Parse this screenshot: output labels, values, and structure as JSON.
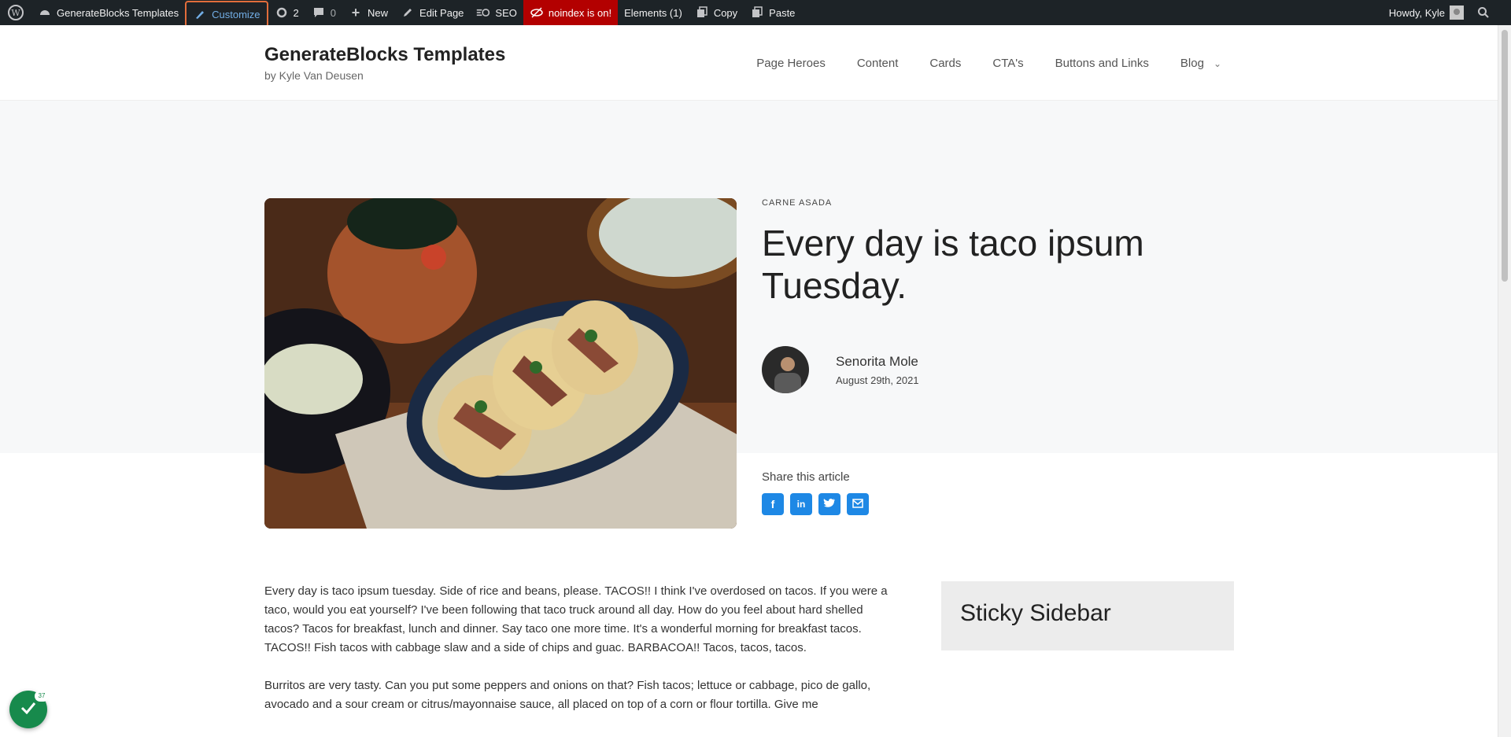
{
  "admin_bar": {
    "site_name": "GenerateBlocks Templates",
    "customize": "Customize",
    "updates_count": "2",
    "comments_count": "0",
    "new": "New",
    "edit_page": "Edit Page",
    "seo": "SEO",
    "noindex": "noindex is on!",
    "elements": "Elements (1)",
    "copy": "Copy",
    "paste": "Paste",
    "howdy": "Howdy, Kyle"
  },
  "header": {
    "site_title": "GenerateBlocks Templates",
    "tagline": "by Kyle Van Deusen",
    "nav": [
      {
        "label": "Page Heroes"
      },
      {
        "label": "Content"
      },
      {
        "label": "Cards"
      },
      {
        "label": "CTA's"
      },
      {
        "label": "Buttons and Links"
      },
      {
        "label": "Blog"
      }
    ]
  },
  "post": {
    "category": "CARNE ASADA",
    "title": "Every day is taco ipsum Tuesday.",
    "author": "Senorita Mole",
    "date": "August 29th, 2021",
    "share_label": "Share this article"
  },
  "content": {
    "paragraphs": [
      "Every day is taco ipsum tuesday. Side of rice and beans, please. TACOS!! I think I've overdosed on tacos. If you were a taco, would you eat yourself? I've been following that taco truck around all day. How do you feel about hard shelled tacos? Tacos for breakfast, lunch and dinner. Say taco one more time. It's a wonderful morning for breakfast tacos. TACOS!! Fish tacos with cabbage slaw and a side of chips and guac. BARBACOA!! Tacos, tacos, tacos.",
      "Burritos are very tasty. Can you put some peppers and onions on that? Fish tacos; lettuce or cabbage, pico de gallo, avocado and a sour cream or citrus/mayonnaise sauce, all placed on top of a corn or flour tortilla. Give me"
    ]
  },
  "sidebar": {
    "title": "Sticky Sidebar"
  },
  "badge": {
    "count": "37"
  }
}
